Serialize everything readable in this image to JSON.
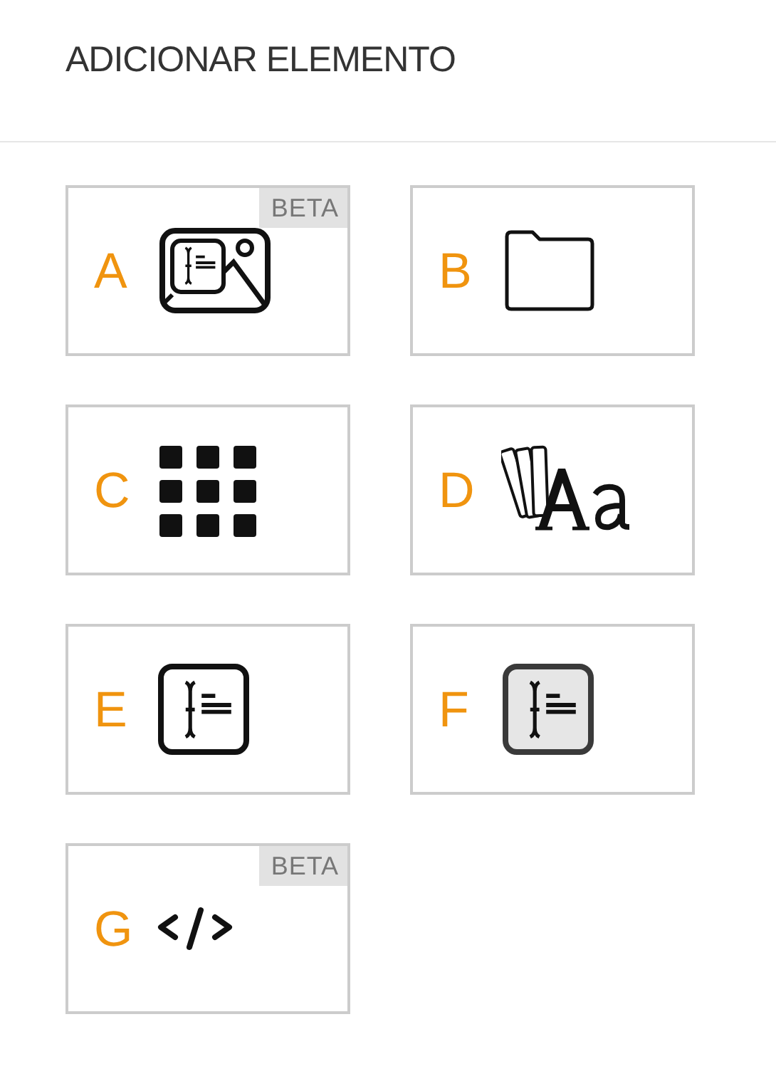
{
  "title": "ADICIONAR ELEMENTO",
  "elements": [
    {
      "letter": "A",
      "kind": "image-text",
      "badge": "BETA"
    },
    {
      "letter": "B",
      "kind": "folder"
    },
    {
      "letter": "C",
      "kind": "grid"
    },
    {
      "letter": "D",
      "kind": "typography"
    },
    {
      "letter": "E",
      "kind": "text-box"
    },
    {
      "letter": "F",
      "kind": "text-box-filled"
    },
    {
      "letter": "G",
      "kind": "code",
      "badge": "BETA"
    }
  ]
}
